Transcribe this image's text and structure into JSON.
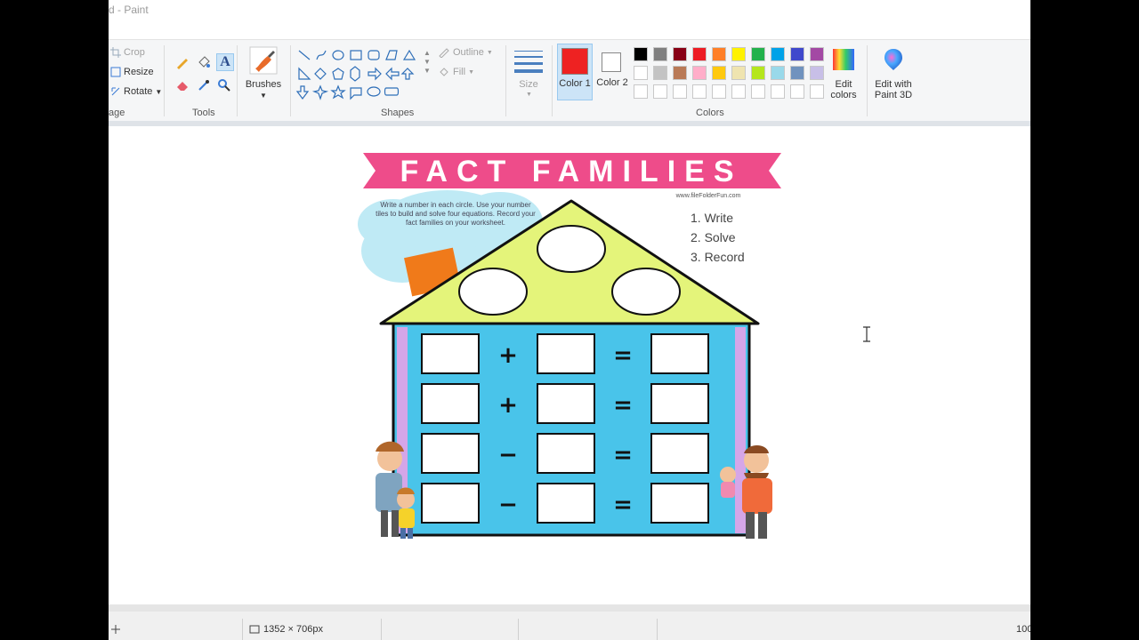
{
  "window": {
    "title": "d - Paint"
  },
  "ribbon": {
    "image": {
      "crop": "Crop",
      "resize": "Resize",
      "rotate": "Rotate",
      "group_label": "age"
    },
    "tools": {
      "group_label": "Tools"
    },
    "brushes": {
      "label": "Brushes"
    },
    "shapes": {
      "outline": "Outline",
      "fill": "Fill",
      "group_label": "Shapes"
    },
    "size": {
      "label": "Size"
    },
    "colors": {
      "color1_label": "Color 1",
      "color2_label": "Color 2",
      "group_label": "Colors",
      "edit_colors": "Edit colors",
      "color1": "#ee2222",
      "color2": "#ffffff",
      "palette_row1": [
        "#000000",
        "#7f7f7f",
        "#880015",
        "#ed1c24",
        "#ff7f27",
        "#fff200",
        "#22b14c",
        "#00a2e8",
        "#3f48cc",
        "#a349a4"
      ],
      "palette_row2": [
        "#ffffff",
        "#c3c3c3",
        "#b97a57",
        "#ffaec9",
        "#ffc90e",
        "#efe4b0",
        "#b5e61d",
        "#99d9ea",
        "#7092be",
        "#c8bfe7"
      ]
    },
    "paint3d": {
      "label": "Edit with Paint 3D"
    }
  },
  "worksheet": {
    "title": "FACT FAMILIES",
    "website": "www.fileFolderFun.com",
    "instructions": "Write a number in each circle. Use your number tiles to build and solve four equations. Record your fact families on your worksheet.",
    "steps": [
      "1. Write",
      "2. Solve",
      "3. Record"
    ],
    "operators": [
      "+",
      "+",
      "−",
      "−"
    ],
    "equals": "="
  },
  "statusbar": {
    "size": "1352 × 706px",
    "zoom": "100"
  }
}
